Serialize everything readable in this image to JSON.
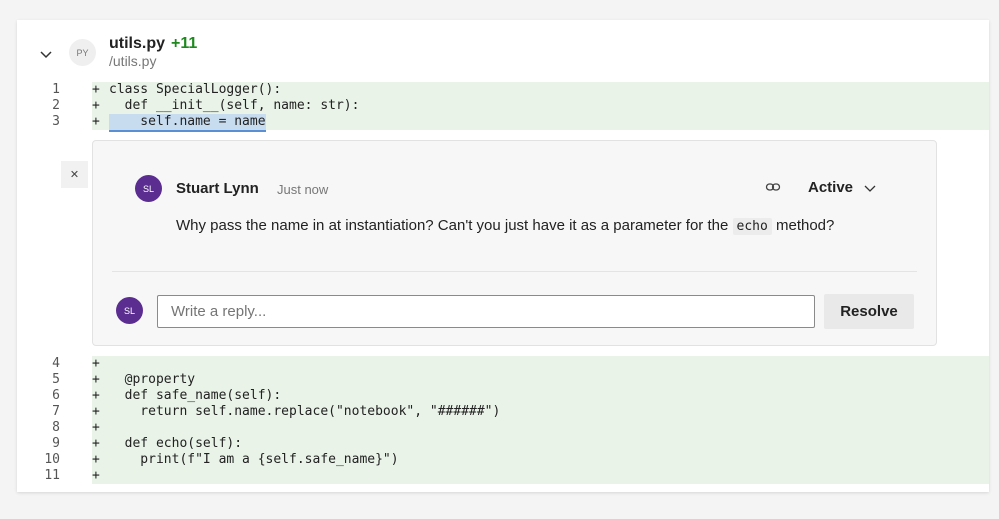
{
  "file": {
    "icon_label": "PY",
    "name": "utils.py",
    "added": "+11",
    "path": "/utils.py"
  },
  "code_top": [
    {
      "n": "1",
      "sign": "+",
      "text": "class SpecialLogger():"
    },
    {
      "n": "2",
      "sign": "+",
      "text": "  def __init__(self, name: str):"
    },
    {
      "n": "3",
      "sign": "+",
      "text": "    self.name = name"
    }
  ],
  "code_bottom": [
    {
      "n": "4",
      "sign": "+",
      "text": ""
    },
    {
      "n": "5",
      "sign": "+",
      "text": "  @property"
    },
    {
      "n": "6",
      "sign": "+",
      "text": "  def safe_name(self):"
    },
    {
      "n": "7",
      "sign": "+",
      "text": "    return self.name.replace(\"notebook\", \"######\")"
    },
    {
      "n": "8",
      "sign": "+",
      "text": ""
    },
    {
      "n": "9",
      "sign": "+",
      "text": "  def echo(self):"
    },
    {
      "n": "10",
      "sign": "+",
      "text": "    print(f\"I am a {self.safe_name}\")"
    },
    {
      "n": "11",
      "sign": "+",
      "text": ""
    }
  ],
  "thread": {
    "avatar": "SL",
    "author": "Stuart Lynn",
    "time": "Just now",
    "status": "Active",
    "body_pre": "Why pass the name in at instantiation? Can't you just have it as a parameter for the ",
    "body_code": "echo",
    "body_post": " method?",
    "reply_avatar": "SL",
    "reply_placeholder": "Write a reply...",
    "resolve_label": "Resolve"
  },
  "colors": {
    "added_bg": "#e9f3e8",
    "added_count": "#1e8a1e",
    "avatar": "#5c2d91",
    "highlight": "#c8dcf0"
  }
}
